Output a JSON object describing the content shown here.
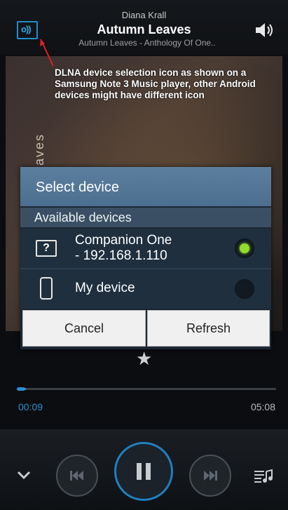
{
  "header": {
    "artist": "Diana Krall",
    "song_title": "Autumn Leaves",
    "album": "Autumn Leaves - Anthology Of One.."
  },
  "album_art": {
    "text": "eaves"
  },
  "annotation": {
    "text": "DLNA device selection icon as shown on a Samsung Note 3 Music player, other Android devices might have different icon"
  },
  "dialog": {
    "title": "Select device",
    "section_label": "Available devices",
    "devices": [
      {
        "icon": "unknown-device-icon",
        "name": "Companion One\n- 192.168.1.110",
        "selected": true
      },
      {
        "icon": "phone-icon",
        "name": "My device",
        "selected": false
      }
    ],
    "cancel_label": "Cancel",
    "refresh_label": "Refresh"
  },
  "player": {
    "time_current": "00:09",
    "time_total": "05:08",
    "progress": 0.029
  },
  "colors": {
    "accent": "#2c8fd0",
    "dialog_title_bg": "#5c7f9f",
    "radio_on": "#8fdc2a",
    "annotation_arrow": "#e02020"
  }
}
